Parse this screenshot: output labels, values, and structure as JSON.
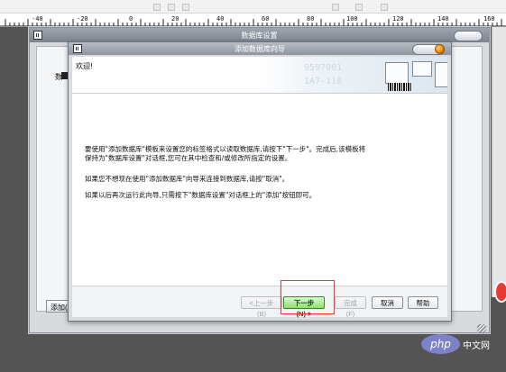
{
  "ruler": {
    "labels": [
      "-40",
      "-20",
      "0",
      "20",
      "40",
      "60",
      "80",
      "100",
      "120",
      "140",
      "160"
    ]
  },
  "outer_dialog": {
    "title": "数据库设置",
    "tree_item_label": "数",
    "add_button_label": "添加(A)"
  },
  "wizard": {
    "title": "添加数据库向导",
    "welcome_heading": "欢迎!",
    "header_watermark_line_1": "9597001",
    "header_watermark_line_2": "1A7-118",
    "body_lines": [
      "要使用\"添加数据库\"模板来设置您的标签格式以读取数据库,请按下\"下一步\"。完成后,该模板将",
      "保持为\"数据库设置\"对话框,您可在其中检查和/或修改所指定的设置。",
      "如果您不想现在使用\"添加数据库\"向导来连接到数据库,请按\"取消\"。",
      "如果以后再次运行此向导,只需按下\"数据库设置\"对话框上的\"添加\"按钮即可。"
    ],
    "buttons": {
      "back": "<上一步(B)",
      "next": "下一步(N) >",
      "finish": "完成(F)",
      "cancel": "取消",
      "help": "帮助"
    }
  },
  "branding": {
    "logo_text": "php",
    "site_text": "中文网"
  },
  "colors": {
    "highlight": "#f03333",
    "next_button": "#8fdc73",
    "brand_logo": "#7d81c7"
  }
}
